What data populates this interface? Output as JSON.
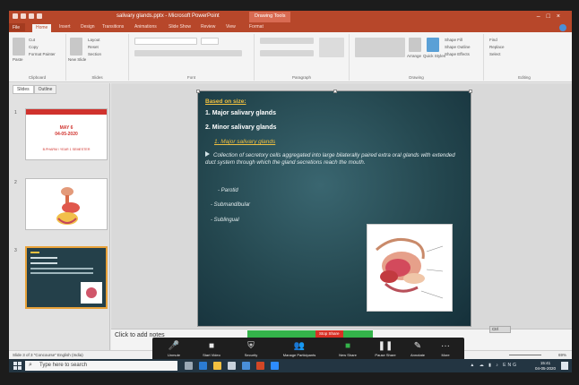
{
  "window": {
    "title": "salivary glands.pptx - Microsoft PowerPoint",
    "context_tab": "Drawing Tools"
  },
  "tabs": [
    "File",
    "Home",
    "Insert",
    "Design",
    "Transitions",
    "Animations",
    "Slide Show",
    "Review",
    "View",
    "Format"
  ],
  "ribbon": {
    "clipboard": {
      "cut": "Cut",
      "copy": "Copy",
      "format_painter": "Format Painter",
      "paste": "Paste",
      "label": "Clipboard"
    },
    "slides": {
      "layout": "Layout",
      "reset": "Reset",
      "new_slide": "New Slide",
      "section": "Section",
      "label": "Slides"
    },
    "font_label": "Font",
    "paragraph_label": "Paragraph",
    "drawing": {
      "shape_fill": "Shape Fill",
      "shape_outline": "Shape Outline",
      "shape_effects": "Shape Effects",
      "arrange": "Arrange",
      "quick_styles": "Quick Styles",
      "label": "Drawing"
    },
    "editing": {
      "find": "Find",
      "replace": "Replace",
      "select": "Select",
      "label": "Editing"
    }
  },
  "thumb_pane": {
    "tabs": [
      "Slides",
      "Outline"
    ],
    "slide1": {
      "num": "1",
      "line1": "MAY 6",
      "line2": "04-05-2020",
      "line3": "B.PHARM / YEAR 1 SEMESTER"
    },
    "slide2": {
      "num": "2"
    },
    "slide3": {
      "num": "3"
    }
  },
  "slide": {
    "heading": "Based on size:",
    "point1": "1. Major salivary glands",
    "point2": "2. Minor salivary glands",
    "sub_heading": "1. Major salivary glands",
    "paragraph": "Collection of secretory cells aggregated into large bilaterally paired extra oral glands with extended duct system through which the gland secretions reach the mouth.",
    "list": [
      "- Parotid",
      "- Submandibular",
      "- Sublingual"
    ]
  },
  "notes_placeholder": "Click to add notes",
  "status": {
    "left": "Slide 3 of 3   \"Concourse\"   English (India)",
    "zoom": "69%"
  },
  "zoom_controls": {
    "stop_share": "Stop Share",
    "buttons": [
      "Unmute",
      "Start Video",
      "Security",
      "Manage Participants",
      "New Share",
      "Pause Share",
      "Annotate",
      "More"
    ]
  },
  "cloud_label": "Ctrl",
  "taskbar": {
    "search_placeholder": "Type here to search",
    "tray": "ENG",
    "time": "15:41",
    "date": "04-05-2020"
  },
  "colors": {
    "accent": "#b7472a",
    "slide_bg": "#24474f",
    "slide_heading": "#f0c040",
    "zoom_bar": "#1e1e1e",
    "share_green": "#34b34a"
  }
}
